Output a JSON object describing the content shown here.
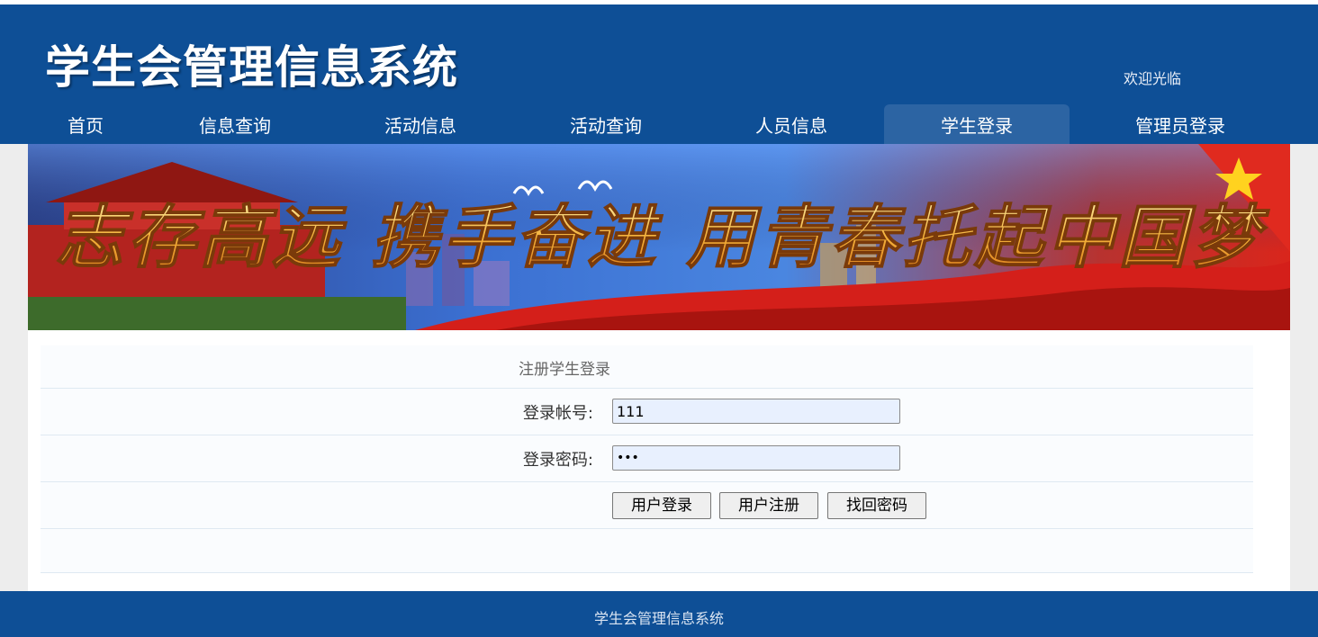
{
  "header": {
    "title": "学生会管理信息系统",
    "welcome": "欢迎光临"
  },
  "nav": {
    "items": [
      {
        "label": "首页"
      },
      {
        "label": "信息查询"
      },
      {
        "label": "活动信息"
      },
      {
        "label": "活动查询"
      },
      {
        "label": "人员信息"
      },
      {
        "label": "学生登录",
        "active": true
      },
      {
        "label": "管理员登录"
      }
    ]
  },
  "banner": {
    "slogan": "志存高远 携手奋进 用青春托起中国梦"
  },
  "form": {
    "title": "注册学生登录",
    "account_label": "登录帐号:",
    "account_value": "111",
    "password_label": "登录密码:",
    "password_value": "•••",
    "buttons": {
      "login": "用户登录",
      "register": "用户注册",
      "recover": "找回密码"
    }
  },
  "footer": {
    "text": "学生会管理信息系统"
  },
  "colors": {
    "header_bg": "#0e4f96",
    "nav_active_bg": "#2c64a3",
    "input_bg": "#e8f0fe"
  }
}
